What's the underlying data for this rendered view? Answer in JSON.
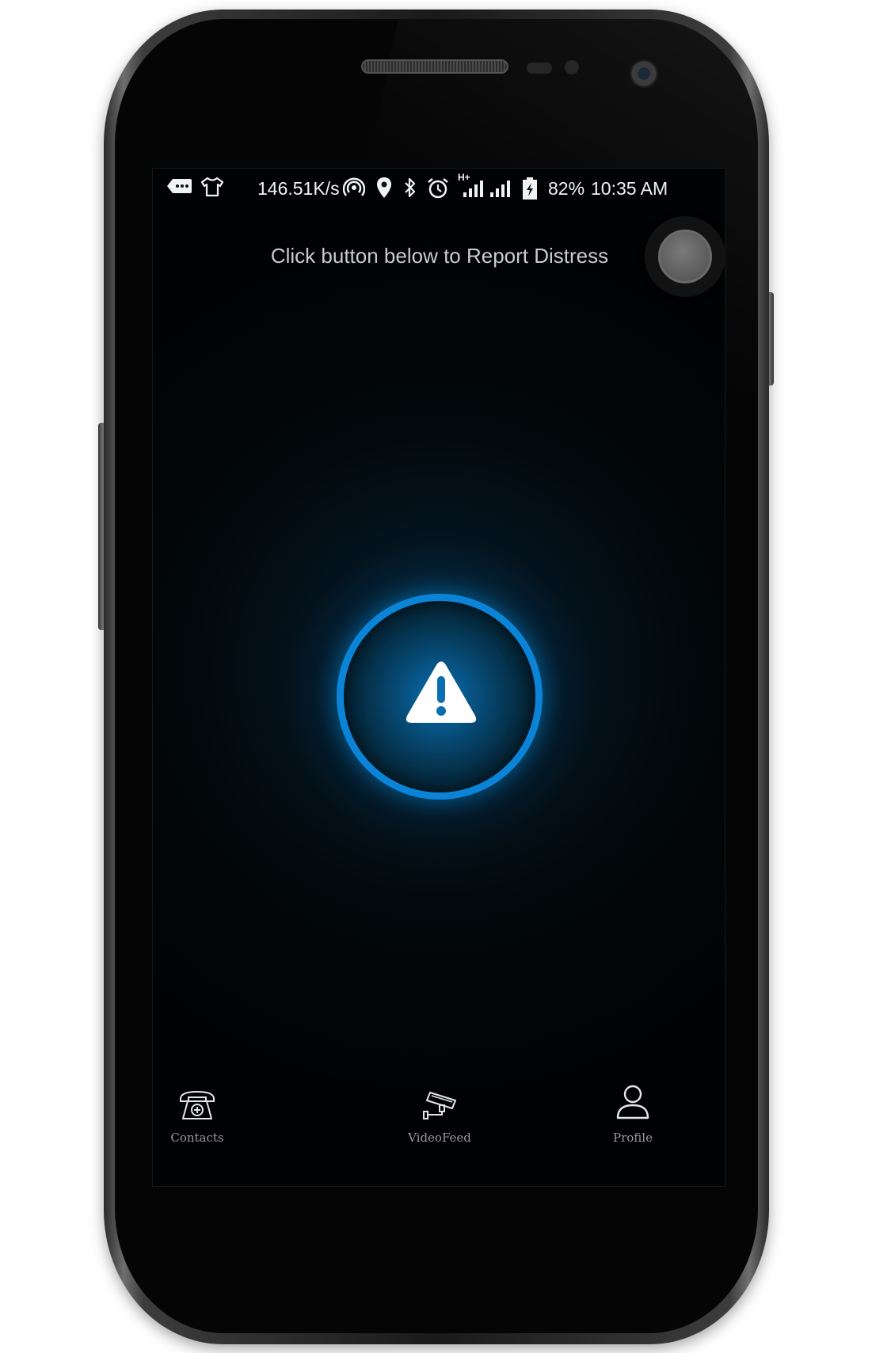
{
  "status_bar": {
    "net_speed": "146.51K/s",
    "network_type": "H+",
    "battery": "82%",
    "time": "10:35 AM",
    "icons": [
      "messaging-icon",
      "tshirt-icon",
      "hotspot-icon",
      "location-icon",
      "bluetooth-icon",
      "alarm-icon",
      "signal-icon",
      "signal-icon",
      "battery-charging-icon"
    ]
  },
  "main": {
    "instruction": "Click button below to Report Distress",
    "distress_button_icon": "warning-icon",
    "accent_color": "#0b84d8"
  },
  "floating_button": {
    "icon": "circle-toggle"
  },
  "bottom_nav": {
    "items": [
      {
        "label": "Contacts",
        "icon": "medical-phone-icon"
      },
      {
        "label": "VideoFeed",
        "icon": "cctv-camera-icon"
      },
      {
        "label": "Profile",
        "icon": "user-icon"
      }
    ]
  }
}
